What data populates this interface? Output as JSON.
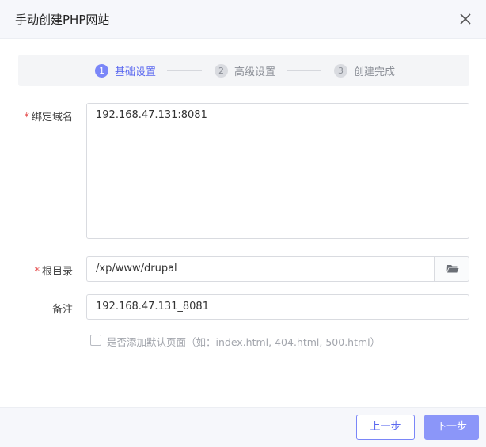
{
  "dialog": {
    "title": "手动创建PHP网站"
  },
  "steps": [
    {
      "num": "1",
      "label": "基础设置",
      "state": "active"
    },
    {
      "num": "2",
      "label": "高级设置",
      "state": "inactive"
    },
    {
      "num": "3",
      "label": "创建完成",
      "state": "inactive"
    }
  ],
  "form": {
    "domain": {
      "required_mark": "*",
      "label": "绑定域名",
      "value": "192.168.47.131:8081"
    },
    "root": {
      "required_mark": "*",
      "label": "根目录",
      "value": "/xp/www/drupal"
    },
    "note": {
      "label": "备注",
      "value": "192.168.47.131_8081"
    },
    "default_page": {
      "checked": false,
      "label": "是否添加默认页面（如：index.html, 404.html, 500.html）"
    }
  },
  "footer": {
    "prev_label": "上一步",
    "next_label": "下一步"
  },
  "icons": {
    "close": "close-icon",
    "folder": "folder-open-icon"
  },
  "colors": {
    "accent": "#7a86f8",
    "required": "#e54b4b"
  }
}
